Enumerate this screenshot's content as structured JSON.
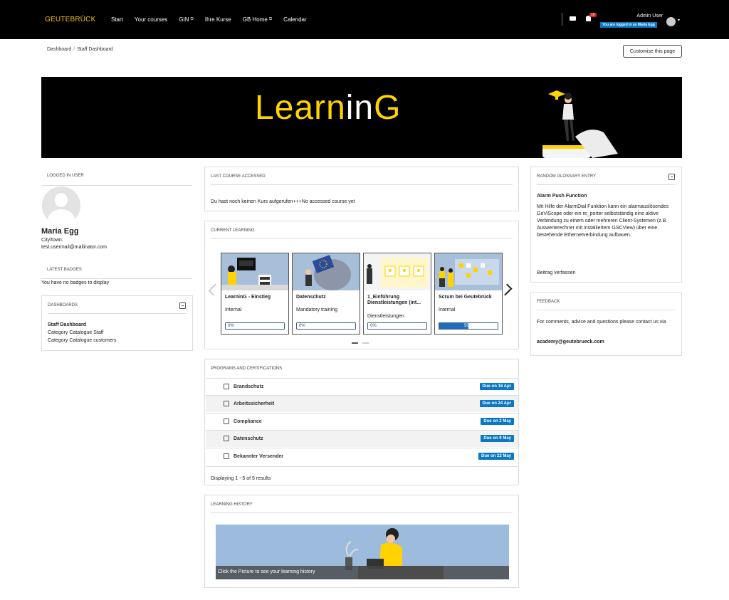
{
  "nav": {
    "brand": "GEUTEBRÜCK",
    "items": [
      {
        "label": "Start",
        "ext": false
      },
      {
        "label": "Your courses",
        "ext": false
      },
      {
        "label": "GIN",
        "ext": true
      },
      {
        "label": "Ihre Kurse",
        "ext": false
      },
      {
        "label": "GB Home",
        "ext": true
      },
      {
        "label": "Calendar",
        "ext": false
      }
    ],
    "notif_count": "10",
    "user": "Admin User",
    "logged_as": "You are logged in as Maria Egg"
  },
  "breadcrumb": {
    "items": [
      "Dashboard",
      "Staff Dashboard"
    ],
    "sep": "/"
  },
  "customise_label": "Customise this page",
  "banner": {
    "part1": "Learn",
    "part2": "in",
    "part3": "G"
  },
  "left": {
    "logged_hdr": "LOGGED IN USER",
    "name": "Maria Egg",
    "city": "City/town:",
    "email": "test.usermail@mailinator.com",
    "badges_hdr": "LATEST BADGES",
    "badges_text": "You have no badges to display",
    "dash_hdr": "DASHBOARDS",
    "dash_items": [
      "Staff Dashboard",
      "Category Catalogue Staff",
      "Category Catalogue customers"
    ]
  },
  "last_course": {
    "hdr": "LAST COURSE ACCESSED",
    "text": "Du hast noch keinen Kurs aufgerufen+++No accessed course yet"
  },
  "current": {
    "hdr": "CURRENT LEARNING",
    "courses": [
      {
        "name": "LearninG - Einstieg",
        "sub": "Internal",
        "progress": 0,
        "pct": "0%"
      },
      {
        "name": "Datenschutz",
        "sub": "Mandatory training",
        "progress": 0,
        "pct": "0%"
      },
      {
        "name": "1_Einführung Dienstleistungen (int...",
        "sub": "Dienstleistungen (Ausführung für MA)",
        "progress": 0,
        "pct": "0%"
      },
      {
        "name": "Scrum bei Geutebrück",
        "sub": "Internal",
        "progress": 0.5,
        "pct": "50%"
      }
    ]
  },
  "programs": {
    "hdr": "PROGRAMS AND CERTIFICATIONS",
    "rows": [
      {
        "name": "Brandschutz",
        "due": "Due on 16 Apr"
      },
      {
        "name": "Arbeitssicherheit",
        "due": "Due on 24 Apr"
      },
      {
        "name": "Compliance",
        "due": "Due on 2 May"
      },
      {
        "name": "Datenschutz",
        "due": "Due on 9 May"
      },
      {
        "name": "Bekannter Versender",
        "due": "Due on 22 May"
      }
    ],
    "footer": "Displaying 1 - 5 of 5 results"
  },
  "history": {
    "hdr": "LEARNING HISTORY",
    "caption": "Click the Picture to see your learning history"
  },
  "glossary": {
    "hdr": "RANDOM GLOSSARY ENTRY",
    "title": "Alarm Push Function",
    "desc": "Mit Hilfe der AlarmDial Funktion kann ein alarmauslösendes GeViScope oder ein re_porter selbstständig eine aktive Verbindung zu einem oder mehreren Client-Systemen (z.B. Auswerterechner mit installiertem GSCView) über eine bestehende Ethernetverbindung aufbauen.",
    "write": "Beitrag verfassen"
  },
  "feedback": {
    "hdr": "FEEDBACK",
    "text": "For comments, advice and questions please contact us via",
    "mail": "academy@geutebrueck.com"
  },
  "colors": {
    "brand": "#f4c300",
    "accent": "#0a78c2"
  }
}
